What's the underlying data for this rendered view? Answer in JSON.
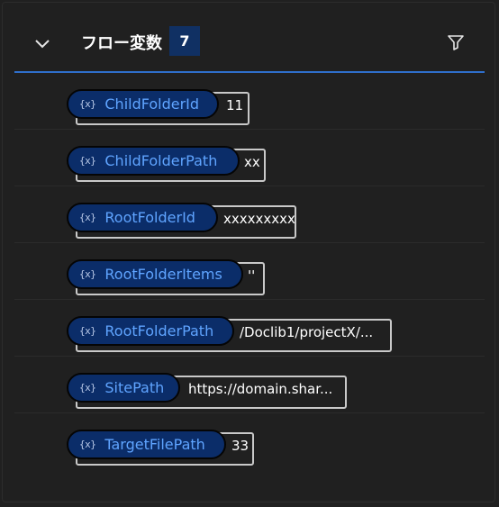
{
  "header": {
    "title": "フロー変数",
    "count": "7",
    "collapse_icon": "chevron-down-icon",
    "filter_icon": "filter-icon"
  },
  "colors": {
    "background": "#202020",
    "accent": "#2f6fcb",
    "badge": "#103063",
    "chip_bg": "#0b2d69",
    "chip_text": "#5fa4ff"
  },
  "variables": [
    {
      "icon": "{x}",
      "name": "ChildFolderId",
      "value": "11"
    },
    {
      "icon": "{x}",
      "name": "ChildFolderPath",
      "value": "xx"
    },
    {
      "icon": "{x}",
      "name": "RootFolderId",
      "value": "xxxxxxxxx"
    },
    {
      "icon": "{x}",
      "name": "RootFolderItems",
      "value": "''"
    },
    {
      "icon": "{x}",
      "name": "RootFolderPath",
      "value": "/Doclib1/projectX/..."
    },
    {
      "icon": "{x}",
      "name": "SitePath",
      "value": "https://domain.shar..."
    },
    {
      "icon": "{x}",
      "name": "TargetFilePath",
      "value": "33"
    }
  ]
}
